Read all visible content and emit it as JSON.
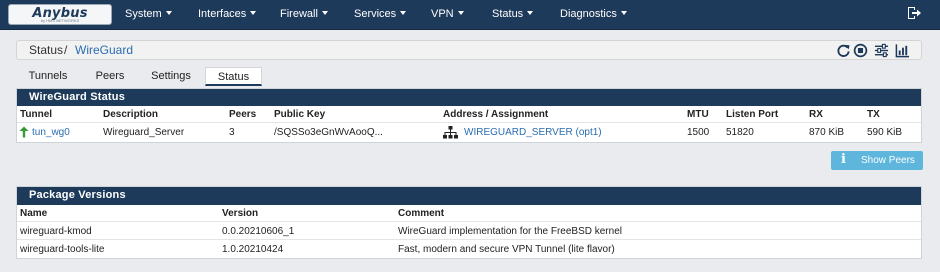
{
  "brand": {
    "name": "Anybus",
    "tagline": "by HMS NETWORKS"
  },
  "nav": {
    "items": [
      {
        "label": "System"
      },
      {
        "label": "Interfaces"
      },
      {
        "label": "Firewall"
      },
      {
        "label": "Services"
      },
      {
        "label": "VPN"
      },
      {
        "label": "Status"
      },
      {
        "label": "Diagnostics"
      }
    ]
  },
  "breadcrumb": {
    "root": "Status",
    "separator": "/",
    "page": "WireGuard"
  },
  "toolbar": {
    "icons": [
      "restart-icon",
      "stop-icon",
      "settings-sliders-icon",
      "chart-icon"
    ]
  },
  "tabs": [
    {
      "label": "Tunnels",
      "active": false
    },
    {
      "label": "Peers",
      "active": false
    },
    {
      "label": "Settings",
      "active": false
    },
    {
      "label": "Status",
      "active": true
    }
  ],
  "status_panel": {
    "title": "WireGuard Status",
    "columns": [
      "Tunnel",
      "Description",
      "Peers",
      "Public Key",
      "Address / Assignment",
      "MTU",
      "Listen Port",
      "RX",
      "TX"
    ],
    "rows": [
      {
        "tunnel": "tun_wg0",
        "description": "Wireguard_Server",
        "peers": "3",
        "public_key": "/SQSSo3eGnWvAooQ...",
        "assignment": "WIREGUARD_SERVER (opt1)",
        "mtu": "1500",
        "listen_port": "51820",
        "rx": "870 KiB",
        "tx": "590 KiB"
      }
    ],
    "show_peers_label": "Show Peers",
    "show_peers_icon_glyph": "i"
  },
  "packages_panel": {
    "title": "Package Versions",
    "columns": [
      "Name",
      "Version",
      "Comment"
    ],
    "rows": [
      {
        "name": "wireguard-kmod",
        "version": "0.0.20210606_1",
        "comment": "WireGuard implementation for the FreeBSD kernel"
      },
      {
        "name": "wireguard-tools-lite",
        "version": "1.0.20210424",
        "comment": "Fast, modern and secure VPN Tunnel (lite flavor)"
      }
    ]
  },
  "colors": {
    "nav_bg": "#1e3a5a",
    "link": "#2a6db0",
    "status_up": "#3a9a3a",
    "button_info": "#5fb6dc"
  }
}
